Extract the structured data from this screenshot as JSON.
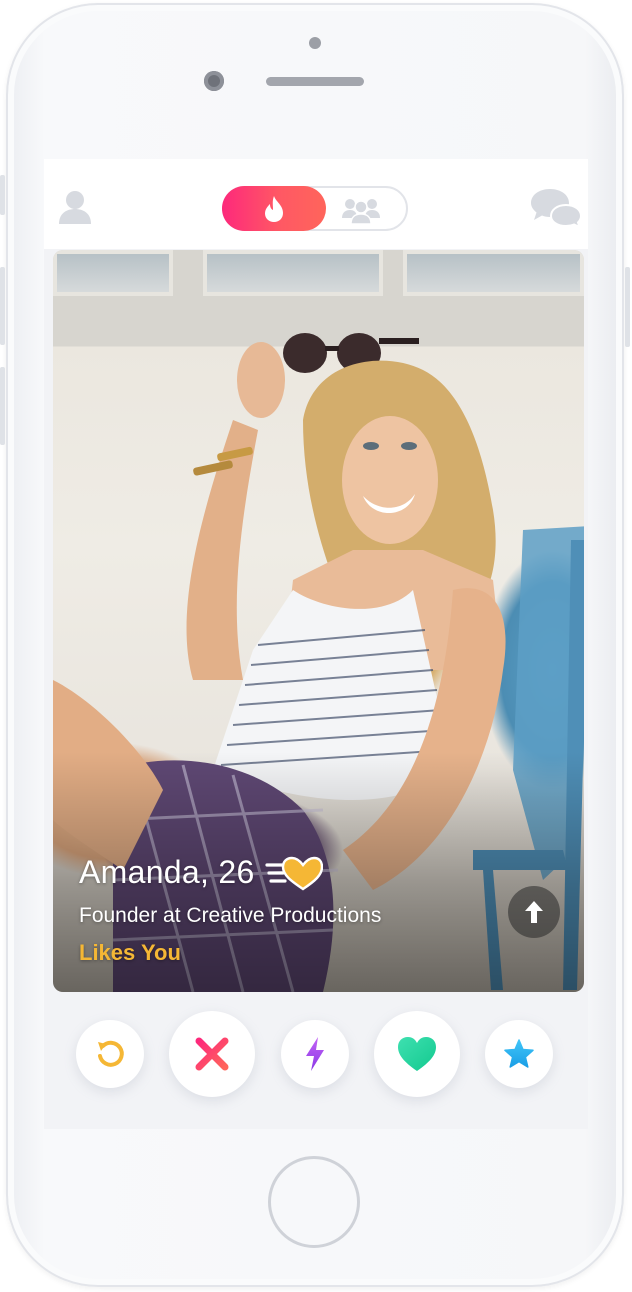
{
  "profile": {
    "name": "Amanda",
    "separator": ",",
    "age": "26",
    "job": "Founder at Creative Productions",
    "likes_badge": "Likes You"
  },
  "topbar": {
    "left_icon": "profile-icon",
    "center_toggle": [
      "flame-icon",
      "group-icon"
    ],
    "right_icon": "messages-icon"
  },
  "actions": [
    {
      "name": "rewind",
      "icon": "rewind-icon",
      "color": "#f5b735"
    },
    {
      "name": "nope",
      "icon": "x-icon",
      "color": "#fd5068"
    },
    {
      "name": "boost",
      "icon": "lightning-icon",
      "color": "#a94bf0"
    },
    {
      "name": "like",
      "icon": "heart-icon",
      "color": "#21d69e"
    },
    {
      "name": "super-like",
      "icon": "star-icon",
      "color": "#2db5f5"
    }
  ],
  "colors": {
    "brand_gradient_start": "#fd297b",
    "brand_gradient_end": "#ff655b",
    "likes_you": "#f5b735",
    "inactive_icon": "#d7dae0"
  }
}
